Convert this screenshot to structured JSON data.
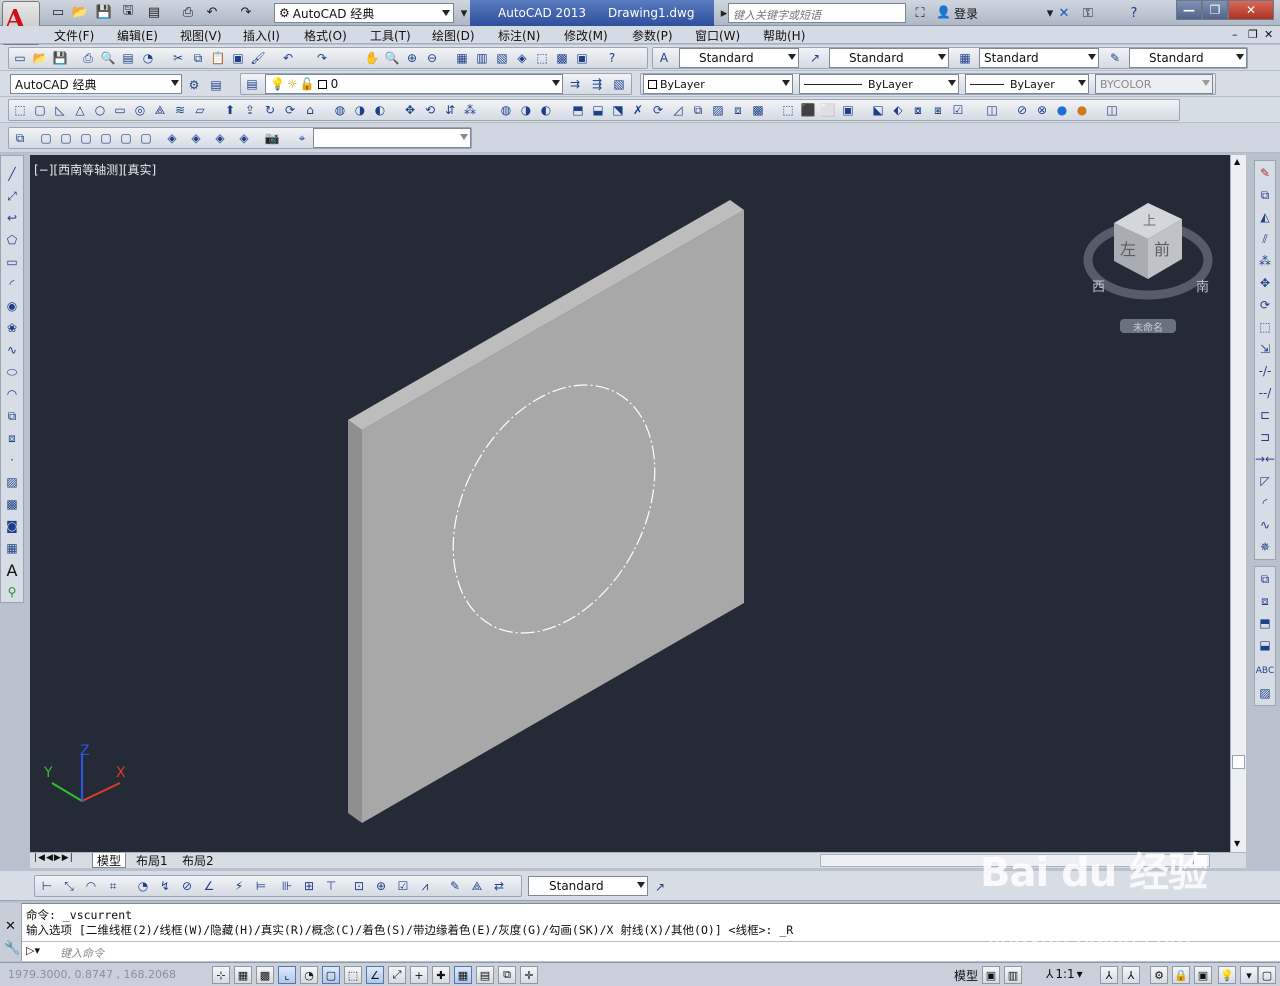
{
  "app": {
    "name_label": "AutoCAD 2013",
    "doc_title": "Drawing1.dwg",
    "logo_letter": "A",
    "workspace": "AutoCAD 经典",
    "search_placeholder": "键入关键字或短语",
    "login_label": "登录"
  },
  "menu": [
    "文件(F)",
    "编辑(E)",
    "视图(V)",
    "插入(I)",
    "格式(O)",
    "工具(T)",
    "绘图(D)",
    "标注(N)",
    "修改(M)",
    "参数(P)",
    "窗口(W)",
    "帮助(H)"
  ],
  "styles": {
    "text_style": "Standard",
    "dim_style": "Standard",
    "table_style": "Standard",
    "mleader_style": "Standard"
  },
  "layers": {
    "workspace_combo": "AutoCAD 经典",
    "current_layer": "0",
    "color": "ByLayer",
    "linetype": "ByLayer",
    "lineweight": "ByLayer",
    "plot_style": "BYCOLOR"
  },
  "viewport": {
    "label": "[−][西南等轴测][真实]",
    "viewcube_top": "上",
    "viewcube_left": "左",
    "viewcube_front": "前",
    "compass_west": "西",
    "compass_south": "南",
    "wcs_label": "未命名"
  },
  "axes": {
    "x": "X",
    "y": "Y",
    "z": "Z"
  },
  "layout_tabs": [
    "模型",
    "布局1",
    "布局2"
  ],
  "draw_toolbar": {
    "dim_style": "Standard"
  },
  "command": {
    "line1": "命令: _vscurrent",
    "line2": "输入选项 [二维线框(2)/线框(W)/隐藏(H)/真实(R)/概念(C)/着色(S)/带边缘着色(E)/灰度(G)/勾画(SK)/X 射线(X)/其他(O)] <线框>: _R",
    "input_placeholder": "键入命令"
  },
  "status": {
    "coords": "1979.3000, 0.8747 , 168.2068",
    "model_label": "模型",
    "annotation_scale": "1:1"
  },
  "watermark": {
    "brand": "Bai du 经验",
    "url": "jingyan.baidu.com"
  },
  "colors": {
    "viewport_bg": "#252b36",
    "title_tab": "#3a5ca6",
    "logo_red": "#c8111b",
    "panel_face": "#a8a8a8",
    "panel_top": "#bdbdbd",
    "panel_side": "#8f8f8f"
  }
}
